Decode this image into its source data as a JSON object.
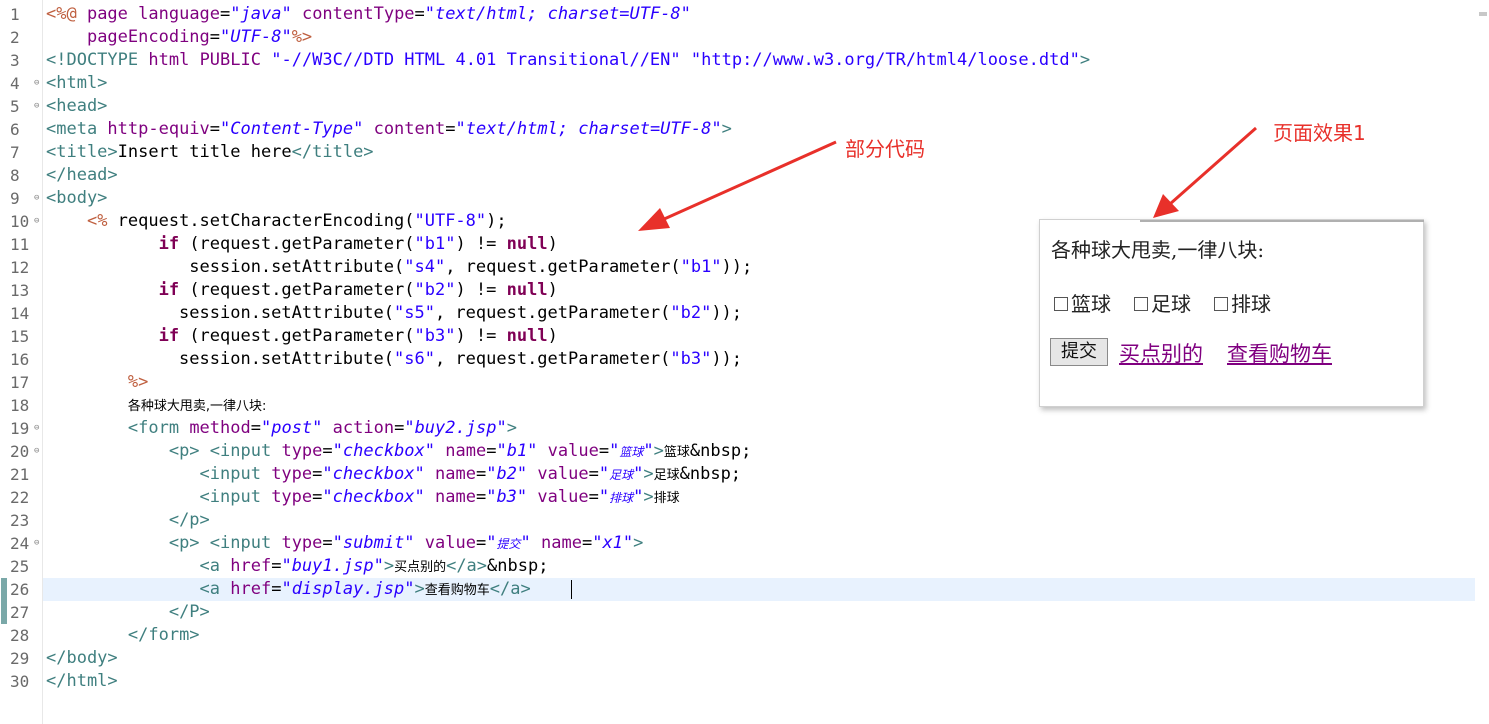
{
  "editor": {
    "lines": [
      {
        "n": "1",
        "fold": "",
        "indent": 0,
        "tokens": [
          [
            "jsp",
            "<%@ "
          ],
          [
            "attr",
            "page "
          ],
          [
            "attr",
            "language"
          ],
          [
            "text",
            "="
          ],
          [
            "val",
            "\"java\""
          ],
          [
            "text",
            " "
          ],
          [
            "attr",
            "contentType"
          ],
          [
            "text",
            "="
          ],
          [
            "val",
            "\"text/html; charset=UTF-8\""
          ]
        ]
      },
      {
        "n": "2",
        "fold": "",
        "indent": 0,
        "tokens": [
          [
            "text",
            "    "
          ],
          [
            "attr",
            "pageEncoding"
          ],
          [
            "text",
            "="
          ],
          [
            "val",
            "\"UTF-8\""
          ],
          [
            "jsp",
            "%>"
          ]
        ]
      },
      {
        "n": "3",
        "fold": "",
        "indent": 0,
        "tokens": [
          [
            "tag",
            "<!DOCTYPE "
          ],
          [
            "attr",
            "html"
          ],
          [
            "text",
            " "
          ],
          [
            "attr",
            "PUBLIC"
          ],
          [
            "text",
            " "
          ],
          [
            "str",
            "\"-//W3C//DTD HTML 4.01 Transitional//EN\""
          ],
          [
            "text",
            " "
          ],
          [
            "str",
            "\"http://www.w3.org/TR/html4/loose.dtd\""
          ],
          [
            "tag",
            ">"
          ]
        ]
      },
      {
        "n": "4",
        "fold": "⊖",
        "indent": 0,
        "tokens": [
          [
            "tag",
            "<html>"
          ]
        ]
      },
      {
        "n": "5",
        "fold": "⊖",
        "indent": 0,
        "tokens": [
          [
            "tag",
            "<head>"
          ]
        ]
      },
      {
        "n": "6",
        "fold": "",
        "indent": 0,
        "tokens": [
          [
            "tag",
            "<meta "
          ],
          [
            "attr",
            "http-equiv"
          ],
          [
            "text",
            "="
          ],
          [
            "val",
            "\"Content-Type\""
          ],
          [
            "text",
            " "
          ],
          [
            "attr",
            "content"
          ],
          [
            "text",
            "="
          ],
          [
            "val",
            "\"text/html; charset=UTF-8\""
          ],
          [
            "tag",
            ">"
          ]
        ]
      },
      {
        "n": "7",
        "fold": "",
        "indent": 0,
        "tokens": [
          [
            "tag",
            "<title>"
          ],
          [
            "text",
            "Insert title here"
          ],
          [
            "tag",
            "</title>"
          ]
        ]
      },
      {
        "n": "8",
        "fold": "",
        "indent": 0,
        "tokens": [
          [
            "tag",
            "</head>"
          ]
        ]
      },
      {
        "n": "9",
        "fold": "⊖",
        "indent": 0,
        "tokens": [
          [
            "tag",
            "<body>"
          ]
        ]
      },
      {
        "n": "10",
        "fold": "⊖",
        "indent": 0,
        "tokens": [
          [
            "text",
            "    "
          ],
          [
            "jsp",
            "<%"
          ],
          [
            "text",
            " request.setCharacterEncoding("
          ],
          [
            "str",
            "\"UTF-8\""
          ],
          [
            "text",
            ");"
          ]
        ]
      },
      {
        "n": "11",
        "fold": "",
        "indent": 0,
        "tokens": [
          [
            "text",
            "           "
          ],
          [
            "kw",
            "if"
          ],
          [
            "text",
            " (request.getParameter("
          ],
          [
            "str",
            "\"b1\""
          ],
          [
            "text",
            ") != "
          ],
          [
            "kw",
            "null"
          ],
          [
            "text",
            ")"
          ]
        ]
      },
      {
        "n": "12",
        "fold": "",
        "indent": 0,
        "tokens": [
          [
            "text",
            "              session.setAttribute("
          ],
          [
            "str",
            "\"s4\""
          ],
          [
            "text",
            ", request.getParameter("
          ],
          [
            "str",
            "\"b1\""
          ],
          [
            "text",
            "));"
          ]
        ]
      },
      {
        "n": "13",
        "fold": "",
        "indent": 0,
        "tokens": [
          [
            "text",
            "           "
          ],
          [
            "kw",
            "if"
          ],
          [
            "text",
            " (request.getParameter("
          ],
          [
            "str",
            "\"b2\""
          ],
          [
            "text",
            ") != "
          ],
          [
            "kw",
            "null"
          ],
          [
            "text",
            ")"
          ]
        ]
      },
      {
        "n": "14",
        "fold": "",
        "indent": 0,
        "tokens": [
          [
            "text",
            "             session.setAttribute("
          ],
          [
            "str",
            "\"s5\""
          ],
          [
            "text",
            ", request.getParameter("
          ],
          [
            "str",
            "\"b2\""
          ],
          [
            "text",
            "));"
          ]
        ]
      },
      {
        "n": "15",
        "fold": "",
        "indent": 0,
        "tokens": [
          [
            "text",
            "           "
          ],
          [
            "kw",
            "if"
          ],
          [
            "text",
            " (request.getParameter("
          ],
          [
            "str",
            "\"b3\""
          ],
          [
            "text",
            ") != "
          ],
          [
            "kw",
            "null"
          ],
          [
            "text",
            ")"
          ]
        ]
      },
      {
        "n": "16",
        "fold": "",
        "indent": 0,
        "tokens": [
          [
            "text",
            "             session.setAttribute("
          ],
          [
            "str",
            "\"s6\""
          ],
          [
            "text",
            ", request.getParameter("
          ],
          [
            "str",
            "\"b3\""
          ],
          [
            "text",
            "));"
          ]
        ]
      },
      {
        "n": "17",
        "fold": "",
        "indent": 0,
        "tokens": [
          [
            "text",
            "        "
          ],
          [
            "jsp",
            "%>"
          ]
        ]
      },
      {
        "n": "18",
        "fold": "",
        "indent": 0,
        "tokens": [
          [
            "text",
            "        "
          ],
          [
            "cjk",
            "各种球大甩卖,一律八块:"
          ]
        ]
      },
      {
        "n": "19",
        "fold": "⊖",
        "indent": 0,
        "tokens": [
          [
            "text",
            "        "
          ],
          [
            "tag",
            "<form "
          ],
          [
            "attr",
            "method"
          ],
          [
            "text",
            "="
          ],
          [
            "val",
            "\"post\""
          ],
          [
            "text",
            " "
          ],
          [
            "attr",
            "action"
          ],
          [
            "text",
            "="
          ],
          [
            "val",
            "\"buy2.jsp\""
          ],
          [
            "tag",
            ">"
          ]
        ]
      },
      {
        "n": "20",
        "fold": "⊖",
        "indent": 0,
        "tokens": [
          [
            "text",
            "            "
          ],
          [
            "tag",
            "<p>"
          ],
          [
            "text",
            " "
          ],
          [
            "tag",
            "<input "
          ],
          [
            "attr",
            "type"
          ],
          [
            "text",
            "="
          ],
          [
            "val",
            "\"checkbox\""
          ],
          [
            "text",
            " "
          ],
          [
            "attr",
            "name"
          ],
          [
            "text",
            "="
          ],
          [
            "val",
            "\"b1\""
          ],
          [
            "text",
            " "
          ],
          [
            "attr",
            "value"
          ],
          [
            "text",
            "="
          ],
          [
            "val",
            "\""
          ],
          [
            "cjkval",
            "篮球"
          ],
          [
            "val",
            "\""
          ],
          [
            "tag",
            ">"
          ],
          [
            "cjk",
            "篮球"
          ],
          [
            "text",
            "&nbsp;"
          ]
        ]
      },
      {
        "n": "21",
        "fold": "",
        "indent": 0,
        "tokens": [
          [
            "text",
            "               "
          ],
          [
            "tag",
            "<input "
          ],
          [
            "attr",
            "type"
          ],
          [
            "text",
            "="
          ],
          [
            "val",
            "\"checkbox\""
          ],
          [
            "text",
            " "
          ],
          [
            "attr",
            "name"
          ],
          [
            "text",
            "="
          ],
          [
            "val",
            "\"b2\""
          ],
          [
            "text",
            " "
          ],
          [
            "attr",
            "value"
          ],
          [
            "text",
            "="
          ],
          [
            "val",
            "\""
          ],
          [
            "cjkval",
            "足球"
          ],
          [
            "val",
            "\""
          ],
          [
            "tag",
            ">"
          ],
          [
            "cjk",
            "足球"
          ],
          [
            "text",
            "&nbsp;"
          ]
        ]
      },
      {
        "n": "22",
        "fold": "",
        "indent": 0,
        "tokens": [
          [
            "text",
            "               "
          ],
          [
            "tag",
            "<input "
          ],
          [
            "attr",
            "type"
          ],
          [
            "text",
            "="
          ],
          [
            "val",
            "\"checkbox\""
          ],
          [
            "text",
            " "
          ],
          [
            "attr",
            "name"
          ],
          [
            "text",
            "="
          ],
          [
            "val",
            "\"b3\""
          ],
          [
            "text",
            " "
          ],
          [
            "attr",
            "value"
          ],
          [
            "text",
            "="
          ],
          [
            "val",
            "\""
          ],
          [
            "cjkval",
            "排球"
          ],
          [
            "val",
            "\""
          ],
          [
            "tag",
            ">"
          ],
          [
            "cjk",
            "排球"
          ]
        ]
      },
      {
        "n": "23",
        "fold": "",
        "indent": 0,
        "tokens": [
          [
            "text",
            "            "
          ],
          [
            "tag",
            "</p>"
          ]
        ]
      },
      {
        "n": "24",
        "fold": "⊖",
        "indent": 0,
        "tokens": [
          [
            "text",
            "            "
          ],
          [
            "tag",
            "<p>"
          ],
          [
            "text",
            " "
          ],
          [
            "tag",
            "<input "
          ],
          [
            "attr",
            "type"
          ],
          [
            "text",
            "="
          ],
          [
            "val",
            "\"submit\""
          ],
          [
            "text",
            " "
          ],
          [
            "attr",
            "value"
          ],
          [
            "text",
            "="
          ],
          [
            "val",
            "\""
          ],
          [
            "cjkval",
            "提交"
          ],
          [
            "val",
            "\""
          ],
          [
            "text",
            " "
          ],
          [
            "attr",
            "name"
          ],
          [
            "text",
            "="
          ],
          [
            "val",
            "\"x1\""
          ],
          [
            "tag",
            ">"
          ]
        ]
      },
      {
        "n": "25",
        "fold": "",
        "indent": 0,
        "tokens": [
          [
            "text",
            "               "
          ],
          [
            "tag",
            "<a "
          ],
          [
            "attr",
            "href"
          ],
          [
            "text",
            "="
          ],
          [
            "val",
            "\"buy1.jsp\""
          ],
          [
            "tag",
            ">"
          ],
          [
            "cjk",
            "买点别的"
          ],
          [
            "tag",
            "</a>"
          ],
          [
            "text",
            "&nbsp;"
          ]
        ]
      },
      {
        "n": "26",
        "fold": "",
        "indent": 0,
        "tokens": [
          [
            "text",
            "               "
          ],
          [
            "tag",
            "<a "
          ],
          [
            "attr",
            "href"
          ],
          [
            "text",
            "="
          ],
          [
            "val",
            "\"display.jsp\""
          ],
          [
            "tag",
            ">"
          ],
          [
            "cjk",
            "查看购物车"
          ],
          [
            "tag",
            "</a>"
          ]
        ]
      },
      {
        "n": "27",
        "fold": "",
        "indent": 0,
        "tokens": [
          [
            "text",
            "            "
          ],
          [
            "tag",
            "</P>"
          ]
        ]
      },
      {
        "n": "28",
        "fold": "",
        "indent": 0,
        "tokens": [
          [
            "text",
            "        "
          ],
          [
            "tag",
            "</form>"
          ]
        ]
      },
      {
        "n": "29",
        "fold": "",
        "indent": 0,
        "tokens": [
          [
            "tag",
            "</body>"
          ]
        ]
      },
      {
        "n": "30",
        "fold": "",
        "indent": 0,
        "tokens": [
          [
            "tag",
            "</html>"
          ]
        ]
      }
    ]
  },
  "annotations": {
    "code_label": "部分代码",
    "preview_label": "页面效果1"
  },
  "preview": {
    "heading": "各种球大甩卖,一律八块:",
    "checkboxes": [
      "篮球",
      "足球",
      "排球"
    ],
    "submit_label": "提交",
    "link1": "买点别的",
    "link2": "查看购物车"
  },
  "colors": {
    "annotation": "#e8302a",
    "link_visited": "#800080",
    "current_line": "#e8f2fe"
  }
}
